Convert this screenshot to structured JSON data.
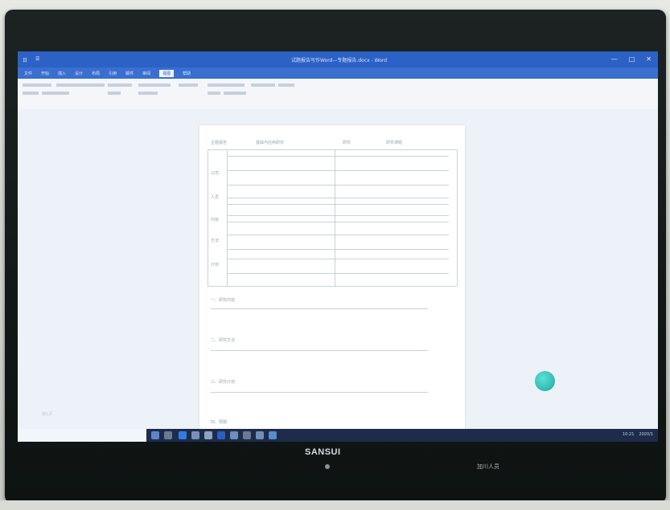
{
  "monitor": {
    "brand": "SANSUI",
    "bottom_right_label": "加川人员"
  },
  "window": {
    "title": "试题报告写作Word—专题报告.docx - Word",
    "quick_left": [
      "日",
      "☰"
    ],
    "controls": {
      "minimize": "—",
      "maximize": "□",
      "close": "✕"
    }
  },
  "ribbon_tabs": [
    "文件",
    "开始",
    "插入",
    "设计",
    "布局",
    "引用",
    "邮件",
    "审阅",
    "视图",
    "帮助"
  ],
  "document": {
    "field_1": "主题报告",
    "field_2": "基础与应用研究",
    "field_3": "研究",
    "field_4": "研究课题",
    "row_label_1": "公司",
    "row_label_2": "人员",
    "row_label_3": "内容",
    "row_label_4": "方法",
    "row_label_5": "计划",
    "section_1": "一、研究内容",
    "section_2": "二、研究方法",
    "section_3": "三、研究计划",
    "section_4": "四、预期"
  },
  "taskbar": {
    "time": "10:21",
    "date": "2020/1"
  },
  "status_left": "第1页"
}
